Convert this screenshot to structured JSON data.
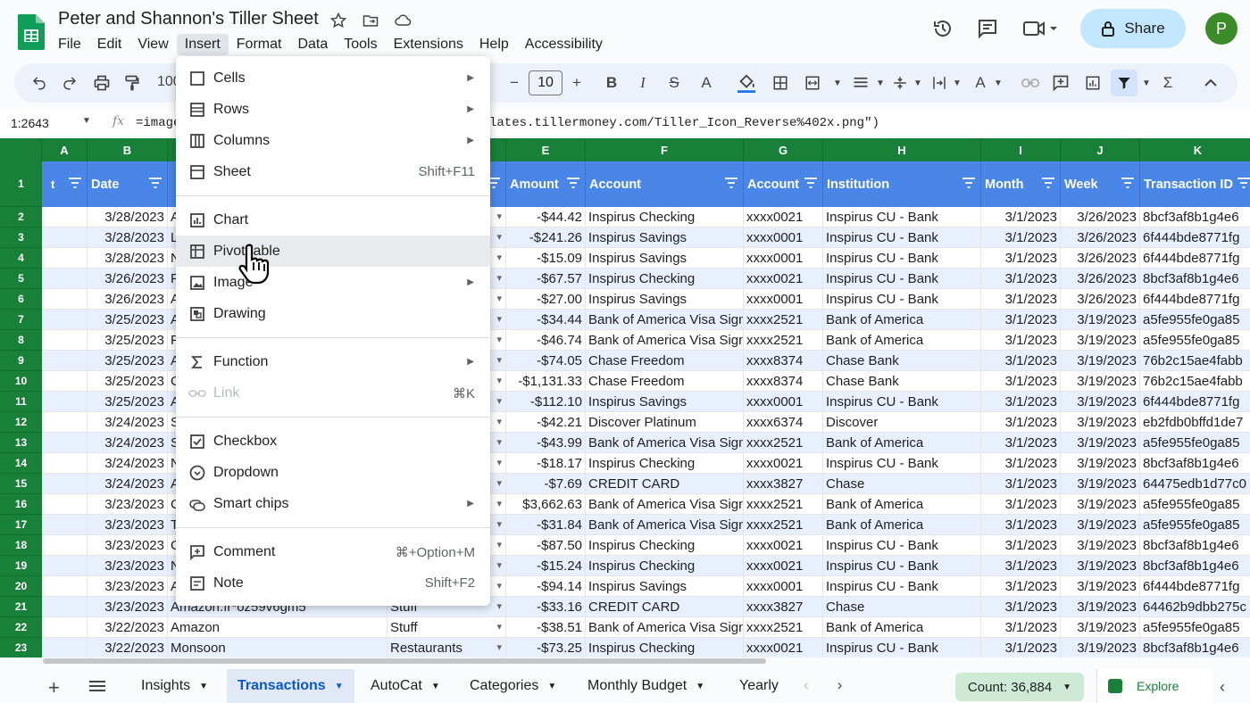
{
  "doc": {
    "title": "Peter and Shannon's Tiller Sheet"
  },
  "menubar": [
    "File",
    "Edit",
    "View",
    "Insert",
    "Format",
    "Data",
    "Tools",
    "Extensions",
    "Help",
    "Accessibility"
  ],
  "share": {
    "label": "Share"
  },
  "avatar": {
    "initial": "P",
    "color": "#3c8b2a"
  },
  "toolbar": {
    "zoom": "100",
    "font_size": "10"
  },
  "formula_bar": {
    "cell_ref": "1:2643",
    "formula_visible_left": "=image",
    "formula_visible_right": "lates.tillermoney.com/Tiller_Icon_Reverse%402x.png\")"
  },
  "grid": {
    "columns": [
      "A",
      "B",
      "E",
      "F",
      "G",
      "H",
      "I",
      "J",
      "K"
    ],
    "headers": {
      "b": "Date",
      "e": "Amount",
      "f": "Account",
      "g": "Account",
      "h": "Institution",
      "i": "Month",
      "j": "Week",
      "k": "Transaction ID"
    },
    "row_numbers": [
      "1",
      "2",
      "3",
      "4",
      "5",
      "6",
      "7",
      "8",
      "9",
      "10",
      "11",
      "12",
      "13",
      "14",
      "15",
      "16",
      "17",
      "18",
      "19",
      "20",
      "21",
      "22",
      "23"
    ],
    "rows": [
      {
        "date": "3/28/2023",
        "desc": "A",
        "cat": "",
        "amount": "-$44.42",
        "account": "Inspirus Checking",
        "acct_num": "xxxx0021",
        "institution": "Inspirus CU - Bank",
        "month": "3/1/2023",
        "week": "3/26/2023",
        "txid": "8bcf3af8b1g4e6"
      },
      {
        "date": "3/28/2023",
        "desc": "L",
        "cat": "",
        "amount": "-$241.26",
        "account": "Inspirus Savings",
        "acct_num": "xxxx0001",
        "institution": "Inspirus CU - Bank",
        "month": "3/1/2023",
        "week": "3/26/2023",
        "txid": "6f444bde8771fg"
      },
      {
        "date": "3/28/2023",
        "desc": "N",
        "cat": "",
        "amount": "-$15.09",
        "account": "Inspirus Savings",
        "acct_num": "xxxx0001",
        "institution": "Inspirus CU - Bank",
        "month": "3/1/2023",
        "week": "3/26/2023",
        "txid": "6f444bde8771fg"
      },
      {
        "date": "3/26/2023",
        "desc": "F",
        "cat": "",
        "amount": "-$67.57",
        "account": "Inspirus Checking",
        "acct_num": "xxxx0021",
        "institution": "Inspirus CU - Bank",
        "month": "3/1/2023",
        "week": "3/26/2023",
        "txid": "8bcf3af8b1g4e6"
      },
      {
        "date": "3/26/2023",
        "desc": "A",
        "cat": "",
        "amount": "-$27.00",
        "account": "Inspirus Savings",
        "acct_num": "xxxx0001",
        "institution": "Inspirus CU - Bank",
        "month": "3/1/2023",
        "week": "3/26/2023",
        "txid": "6f444bde8771fg"
      },
      {
        "date": "3/25/2023",
        "desc": "A",
        "cat": "",
        "amount": "-$34.44",
        "account": "Bank of America Visa Sign",
        "acct_num": "xxxx2521",
        "institution": "Bank of America",
        "month": "3/1/2023",
        "week": "3/19/2023",
        "txid": "a5fe955fe0ga85"
      },
      {
        "date": "3/25/2023",
        "desc": "F",
        "cat": "",
        "amount": "-$46.74",
        "account": "Bank of America Visa Sign",
        "acct_num": "xxxx2521",
        "institution": "Bank of America",
        "month": "3/1/2023",
        "week": "3/19/2023",
        "txid": "a5fe955fe0ga85"
      },
      {
        "date": "3/25/2023",
        "desc": "A",
        "cat": "",
        "amount": "-$74.05",
        "account": "Chase Freedom",
        "acct_num": "xxxx8374",
        "institution": "Chase Bank",
        "month": "3/1/2023",
        "week": "3/19/2023",
        "txid": "76b2c15ae4fabb"
      },
      {
        "date": "3/25/2023",
        "desc": "C",
        "cat": "",
        "amount": "-$1,131.33",
        "account": "Chase Freedom",
        "acct_num": "xxxx8374",
        "institution": "Chase Bank",
        "month": "3/1/2023",
        "week": "3/19/2023",
        "txid": "76b2c15ae4fabb"
      },
      {
        "date": "3/25/2023",
        "desc": "A",
        "cat": "",
        "amount": "-$112.10",
        "account": "Inspirus Savings",
        "acct_num": "xxxx0001",
        "institution": "Inspirus CU - Bank",
        "month": "3/1/2023",
        "week": "3/19/2023",
        "txid": "6f444bde8771fg"
      },
      {
        "date": "3/24/2023",
        "desc": "S",
        "cat": "",
        "amount": "-$42.21",
        "account": "Discover Platinum",
        "acct_num": "xxxx6374",
        "institution": "Discover",
        "month": "3/1/2023",
        "week": "3/19/2023",
        "txid": "eb2fdb0bffd1de7"
      },
      {
        "date": "3/24/2023",
        "desc": "S",
        "cat": "",
        "amount": "-$43.99",
        "account": "Bank of America Visa Sign",
        "acct_num": "xxxx2521",
        "institution": "Bank of America",
        "month": "3/1/2023",
        "week": "3/19/2023",
        "txid": "a5fe955fe0ga85"
      },
      {
        "date": "3/24/2023",
        "desc": "N",
        "cat": "",
        "amount": "-$18.17",
        "account": "Inspirus Checking",
        "acct_num": "xxxx0021",
        "institution": "Inspirus CU - Bank",
        "month": "3/1/2023",
        "week": "3/19/2023",
        "txid": "8bcf3af8b1g4e6"
      },
      {
        "date": "3/24/2023",
        "desc": "A",
        "cat": "",
        "amount": "-$7.69",
        "account": "CREDIT CARD",
        "acct_num": "xxxx3827",
        "institution": "Chase",
        "month": "3/1/2023",
        "week": "3/19/2023",
        "txid": "64475edb1d77c0"
      },
      {
        "date": "3/23/2023",
        "desc": "C",
        "cat": "",
        "amount": "$3,662.63",
        "account": "Bank of America Visa Sign",
        "acct_num": "xxxx2521",
        "institution": "Bank of America",
        "month": "3/1/2023",
        "week": "3/19/2023",
        "txid": "a5fe955fe0ga85"
      },
      {
        "date": "3/23/2023",
        "desc": "T",
        "cat": "",
        "amount": "-$31.84",
        "account": "Bank of America Visa Sign",
        "acct_num": "xxxx2521",
        "institution": "Bank of America",
        "month": "3/1/2023",
        "week": "3/19/2023",
        "txid": "a5fe955fe0ga85"
      },
      {
        "date": "3/23/2023",
        "desc": "C",
        "cat": "",
        "amount": "-$87.50",
        "account": "Inspirus Checking",
        "acct_num": "xxxx0021",
        "institution": "Inspirus CU - Bank",
        "month": "3/1/2023",
        "week": "3/19/2023",
        "txid": "8bcf3af8b1g4e6"
      },
      {
        "date": "3/23/2023",
        "desc": "N",
        "cat": "",
        "amount": "-$15.24",
        "account": "Inspirus Checking",
        "acct_num": "xxxx0021",
        "institution": "Inspirus CU - Bank",
        "month": "3/1/2023",
        "week": "3/19/2023",
        "txid": "8bcf3af8b1g4e6"
      },
      {
        "date": "3/23/2023",
        "desc": "A",
        "cat": "",
        "amount": "-$94.14",
        "account": "Inspirus Savings",
        "acct_num": "xxxx0001",
        "institution": "Inspirus CU - Bank",
        "month": "3/1/2023",
        "week": "3/19/2023",
        "txid": "6f444bde8771fg"
      },
      {
        "date": "3/23/2023",
        "desc": "Amazon.fr*oz59v6gm5",
        "cat": "Stuff",
        "amount": "-$33.16",
        "account": "CREDIT CARD",
        "acct_num": "xxxx3827",
        "institution": "Chase",
        "month": "3/1/2023",
        "week": "3/19/2023",
        "txid": "64462b9dbb275c"
      },
      {
        "date": "3/22/2023",
        "desc": "Amazon",
        "cat": "Stuff",
        "amount": "-$38.51",
        "account": "Bank of America Visa Sign",
        "acct_num": "xxxx2521",
        "institution": "Bank of America",
        "month": "3/1/2023",
        "week": "3/19/2023",
        "txid": "a5fe955fe0ga85"
      },
      {
        "date": "3/22/2023",
        "desc": "Monsoon",
        "cat": "Restaurants",
        "amount": "-$73.25",
        "account": "Inspirus Checking",
        "acct_num": "xxxx0021",
        "institution": "Inspirus CU - Bank",
        "month": "3/1/2023",
        "week": "3/19/2023",
        "txid": "8bcf3af8b1g4e6"
      }
    ]
  },
  "insert_menu": {
    "items": [
      {
        "label": "Cells",
        "icon": "cells-icon",
        "shortcut": "",
        "submenu": true
      },
      {
        "label": "Rows",
        "icon": "rows-icon",
        "shortcut": "",
        "submenu": true
      },
      {
        "label": "Columns",
        "icon": "columns-icon",
        "shortcut": "",
        "submenu": true
      },
      {
        "label": "Sheet",
        "icon": "sheet-icon",
        "shortcut": "Shift+F11",
        "submenu": false
      },
      {
        "label": "Chart",
        "icon": "chart-icon",
        "shortcut": "",
        "submenu": false
      },
      {
        "label": "Pivot table",
        "icon": "pivot-table-icon",
        "shortcut": "",
        "submenu": false
      },
      {
        "label": "Image",
        "icon": "image-icon",
        "shortcut": "",
        "submenu": true
      },
      {
        "label": "Drawing",
        "icon": "drawing-icon",
        "shortcut": "",
        "submenu": false
      },
      {
        "label": "Function",
        "icon": "sigma-icon",
        "shortcut": "",
        "submenu": true
      },
      {
        "label": "Link",
        "icon": "link-icon",
        "shortcut": "⌘K",
        "submenu": false,
        "disabled": true
      },
      {
        "label": "Checkbox",
        "icon": "checkbox-icon",
        "shortcut": "",
        "submenu": false
      },
      {
        "label": "Dropdown",
        "icon": "dropdown-icon",
        "shortcut": "",
        "submenu": false
      },
      {
        "label": "Smart chips",
        "icon": "smart-chips-icon",
        "shortcut": "",
        "submenu": true
      },
      {
        "label": "Comment",
        "icon": "comment-icon",
        "shortcut": "⌘+Option+M",
        "submenu": false
      },
      {
        "label": "Note",
        "icon": "note-icon",
        "shortcut": "Shift+F2",
        "submenu": false
      }
    ],
    "hovered": "Pivot table"
  },
  "sheet_tabs": [
    "Insights",
    "Transactions",
    "AutoCat",
    "Categories",
    "Monthly Budget",
    "Yearly"
  ],
  "active_tab": "Transactions",
  "status": {
    "count": "Count: 36,884",
    "explore": "Explore"
  },
  "colors": {
    "grid_header_green": "#188038",
    "header_blue": "#4a86e8",
    "alt_row": "#e8f0fe",
    "share_bg": "#c2e7ff"
  }
}
